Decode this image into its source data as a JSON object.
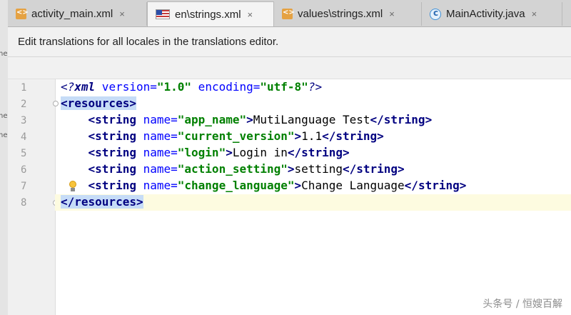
{
  "tabs": [
    {
      "label": "activity_main.xml",
      "icon": "xml-file-icon",
      "close": "×"
    },
    {
      "label": "en\\strings.xml",
      "icon": "us-flag-icon",
      "close": "×",
      "active": true
    },
    {
      "label": "values\\strings.xml",
      "icon": "xml-file-icon",
      "close": "×"
    },
    {
      "label": "MainActivity.java",
      "icon": "java-class-icon",
      "close": "×"
    }
  ],
  "banner": {
    "text": "Edit translations for all locales in the translations editor."
  },
  "left_strip_fragments": [
    "ne",
    "ne",
    "ne"
  ],
  "editor": {
    "line_numbers": [
      "1",
      "2",
      "3",
      "4",
      "5",
      "6",
      "7",
      "8"
    ],
    "caret_line": 8,
    "lines": [
      {
        "pi_open": "<?",
        "pi_name": "xml",
        "a1": " version=",
        "v1": "\"1.0\"",
        "a2": " encoding=",
        "v2": "\"utf-8\"",
        "pi_close": "?>"
      },
      {
        "tag": "<resources>"
      },
      {
        "indent": "    ",
        "open": "<string",
        "attr": " name=",
        "val": "\"app_name\"",
        "gt": ">",
        "text": "MutiLanguage Test",
        "close": "</string>"
      },
      {
        "indent": "    ",
        "open": "<string",
        "attr": " name=",
        "val": "\"current_version\"",
        "gt": ">",
        "text": "1.1",
        "close": "</string>"
      },
      {
        "indent": "    ",
        "open": "<string",
        "attr": " name=",
        "val": "\"login\"",
        "gt": ">",
        "text": "Login in",
        "close": "</string>"
      },
      {
        "indent": "    ",
        "open": "<string",
        "attr": " name=",
        "val": "\"action_setting\"",
        "gt": ">",
        "text": "setting",
        "close": "</string>"
      },
      {
        "indent": "    ",
        "open": "<string",
        "attr": " name=",
        "val": "\"change_language\"",
        "gt": ">",
        "text": "Change Language",
        "close": "</string>"
      },
      {
        "tag": "</resources>"
      }
    ]
  },
  "watermark": "头条号 / 恒嫂百解",
  "colors": {
    "xml_tag": "#000080",
    "xml_attr": "#0000ff",
    "xml_value": "#008000",
    "tag_highlight": "#c6dcf7",
    "caret_line": "#fdfbe0"
  }
}
